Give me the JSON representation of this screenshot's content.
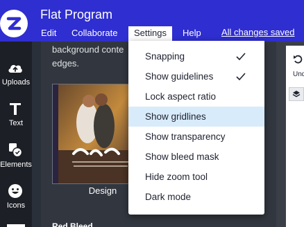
{
  "header": {
    "title": "Flat Program",
    "save_status": "All changes saved",
    "brand_color": "#2f2ed0"
  },
  "menubar": {
    "items": [
      {
        "label": "Edit"
      },
      {
        "label": "Collaborate"
      },
      {
        "label": "Settings",
        "active": true
      },
      {
        "label": "Help"
      }
    ]
  },
  "sidebar": {
    "items": [
      {
        "label": "Uploads",
        "icon": "cloud-upload-icon"
      },
      {
        "label": "Text",
        "icon": "text-icon"
      },
      {
        "label": "Elements",
        "icon": "elements-icon"
      },
      {
        "label": "Icons",
        "icon": "smiley-icon"
      }
    ]
  },
  "panel": {
    "text_line1": "background conte",
    "text_line2": "edges.",
    "thumbnail_caption": "Design",
    "section_title": "Red Bleed"
  },
  "right_panel": {
    "undo_label": "Und"
  },
  "settings_menu": {
    "items": [
      {
        "label": "Snapping",
        "checked": true
      },
      {
        "label": "Show guidelines",
        "checked": true
      },
      {
        "label": "Lock aspect ratio",
        "checked": false
      },
      {
        "label": "Show gridlines",
        "checked": false,
        "highlighted": true
      },
      {
        "label": "Show transparency",
        "checked": false
      },
      {
        "label": "Show bleed mask",
        "checked": false
      },
      {
        "label": "Hide zoom tool",
        "checked": false
      },
      {
        "label": "Dark mode",
        "checked": false
      }
    ]
  }
}
